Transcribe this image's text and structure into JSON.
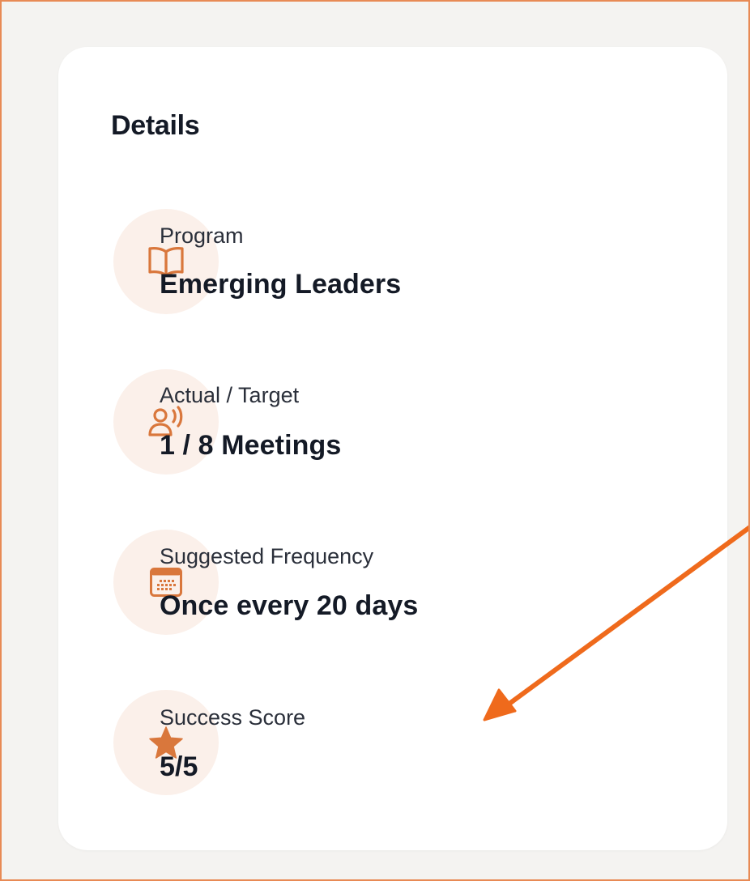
{
  "details": {
    "title": "Details",
    "items": [
      {
        "icon": "book-icon",
        "label": "Program",
        "value": "Emerging Leaders"
      },
      {
        "icon": "speaking-person-icon",
        "label": "Actual / Target",
        "value": "1 / 8 Meetings"
      },
      {
        "icon": "calendar-icon",
        "label": "Suggested Frequency",
        "value": "Once every 20 days"
      },
      {
        "icon": "star-icon",
        "label": "Success Score",
        "value": "5/5"
      }
    ]
  },
  "colors": {
    "accent": "#d9773c",
    "icon_bg": "#fbf0ea",
    "annotation_arrow": "#ef6a1c",
    "page_bg": "#f4f3f1",
    "card_bg": "#ffffff"
  }
}
